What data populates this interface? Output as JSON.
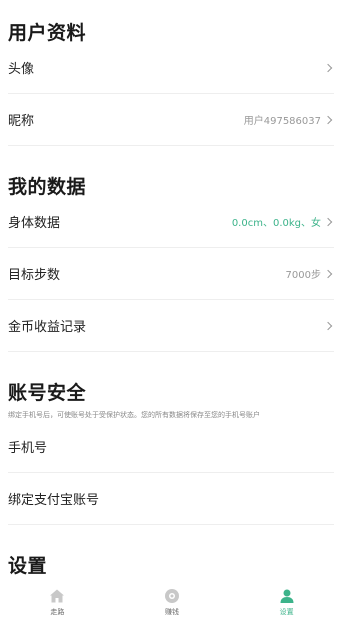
{
  "profile": {
    "title": "用户资料",
    "avatar_label": "头像",
    "nickname_label": "昵称",
    "nickname_value": "用户497586037"
  },
  "data": {
    "title": "我的数据",
    "body_label": "身体数据",
    "body_value": "0.0cm、0.0kg、女",
    "steps_label": "目标步数",
    "steps_value": "7000步",
    "coins_label": "金币收益记录"
  },
  "security": {
    "title": "账号安全",
    "hint": "绑定手机号后，可使账号处于受保护状态。您的所有数据将保存至您的手机号账户",
    "phone_label": "手机号",
    "alipay_label": "绑定支付宝账号"
  },
  "settings": {
    "title": "设置"
  },
  "tabbar": {
    "walk_label": "走路",
    "earn_label": "赚钱",
    "settings_label": "设置"
  },
  "colors": {
    "accent": "#3cb38a",
    "inactive_icon": "#c8c8c8"
  }
}
